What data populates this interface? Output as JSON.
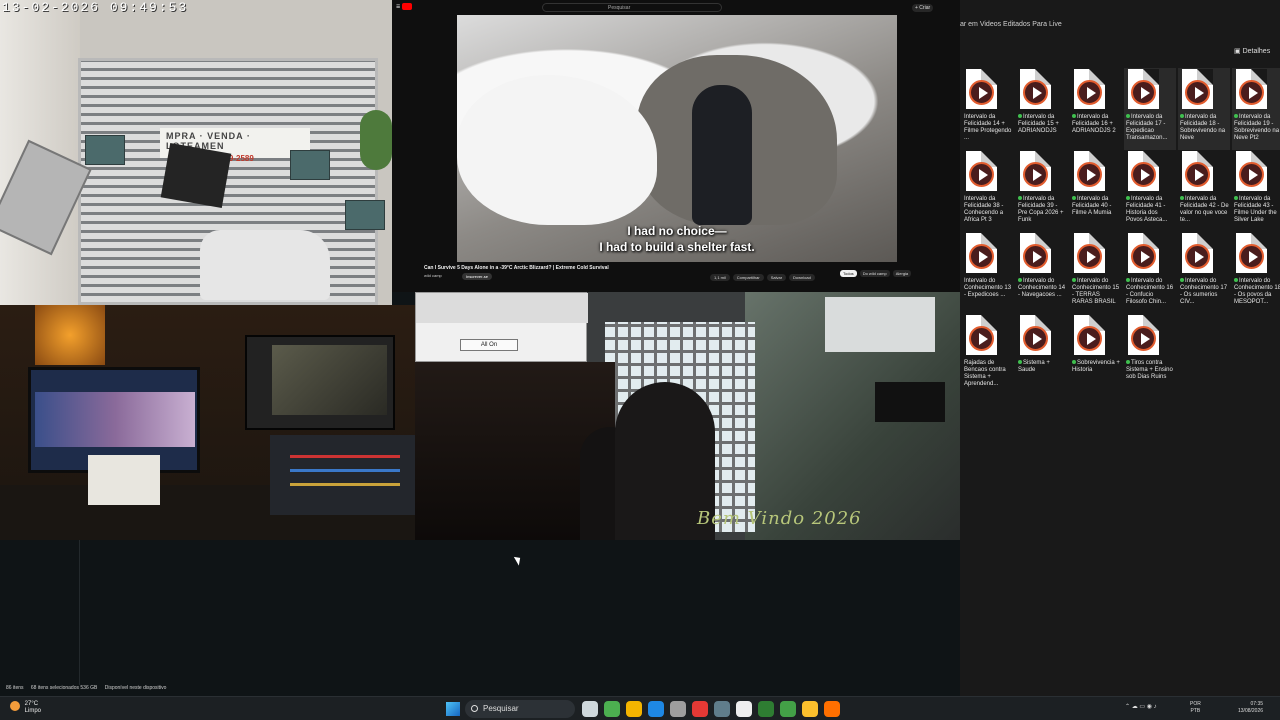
{
  "camera_overlay": {
    "timestamp": "13-02-2026 09:49:53",
    "sign_top": "MPRA · VENDA · LOTEAMEN",
    "sign_phone": "866 5899-2589"
  },
  "youtube": {
    "search_placeholder": "Pesquisar",
    "create_label": "+ Criar",
    "subtitle_line1": "I had no choice—",
    "subtitle_line2": "I had to build a shelter fast.",
    "video_title": "Can I Survive 5 Days Alone in a -39°C Arctic Blizzard? | Extreme Cold Survival",
    "channel": "wild camp",
    "subscribe_label": "Inscrever-se",
    "actions": [
      "1,1 mil",
      "Compartilhar",
      "Salvar",
      "Download"
    ],
    "chips": [
      "Todos",
      "Do wild camp",
      "Alergia"
    ],
    "chips_active": 0
  },
  "room_cam": {
    "button_all_on": "All On",
    "overlay_text": "Bem Vindo 2026"
  },
  "explorer": {
    "address": "ar em Videos Editados Para Live",
    "details_label": "Detalhes",
    "files": [
      {
        "label": "Intervalo da Felicidade 14 + Filme Protegendo ...",
        "sync": false
      },
      {
        "label": "Intervalo da Felicidade 15 + ADRIANODJS",
        "sync": true
      },
      {
        "label": "Intervalo da Felicidade 16 + ADRIANODJS 2",
        "sync": true
      },
      {
        "label": "Intervalo da Felicidade 17 - Expedicao Transamazon...",
        "sync": true
      },
      {
        "label": "Intervalo da Felicidade 18 - Sobrevivendo na Neve",
        "sync": true
      },
      {
        "label": "Intervalo da Felicidade 19 - Sobrevivendo na Neve Pt2",
        "sync": true
      },
      {
        "label": "Intervalo da Felicidade 38 - Conhecendo a Africa Pt 3",
        "sync": false
      },
      {
        "label": "Intervalo da Felicidade 39 - Pre Copa 2026 + Funk",
        "sync": true
      },
      {
        "label": "Intervalo da Felicidade 40 - Filme A Mumia",
        "sync": true
      },
      {
        "label": "Intervalo da Felicidade 41 - Historia dos Povos Asteca...",
        "sync": true
      },
      {
        "label": "Intervalo da Felicidade 42 - De valor no que voce te...",
        "sync": true
      },
      {
        "label": "Intervalo da Felicidade 43 - Filme Under the Silver Lake",
        "sync": true
      },
      {
        "label": "Intervalo do Conhecimento 13 - Expedicoes ...",
        "sync": false
      },
      {
        "label": "Intervalo do Conhecimento 14 - Navegacoes ...",
        "sync": true
      },
      {
        "label": "Intervalo do Conhecimento 15 - TERRAS RARAS BRASIL",
        "sync": true
      },
      {
        "label": "Intervalo do Conhecimento 16 - Confucio Filosofo Chin...",
        "sync": true
      },
      {
        "label": "Intervalo do Conhecimento 17 - Os sumerios CIV...",
        "sync": true
      },
      {
        "label": "Intervalo do Conhecimento 18 - Os povos da MESOPOT...",
        "sync": true
      },
      {
        "label": "Rajadas de Bencaos contra Sistema + Aprendend...",
        "sync": false
      },
      {
        "label": "Sistema + Saude",
        "sync": true
      },
      {
        "label": "Sobrevivencia + Historia",
        "sync": true
      },
      {
        "label": "Tiros contra Sistema + Ensino sob Dias Ruins",
        "sync": true
      }
    ]
  },
  "status_bar": {
    "items": "86 itens",
    "selected": "68 itens selecionados  536 GB",
    "availability": "Disponível neste dispositivo"
  },
  "taskbar": {
    "temperature": "27°C",
    "condition": "Limpo",
    "search_label": "Pesquisar",
    "lang_line1": "POR",
    "lang_line2": "PTB",
    "time": "07:35",
    "date": "13/08/2026",
    "app_colors": [
      "#cfd8dc",
      "#4caf50",
      "#f4b400",
      "#1e88e5",
      "#9e9e9e",
      "#e53935",
      "#607d8b",
      "#eeeeee",
      "#2e7d32",
      "#43a047",
      "#fbc02d",
      "#ff6f00"
    ]
  }
}
